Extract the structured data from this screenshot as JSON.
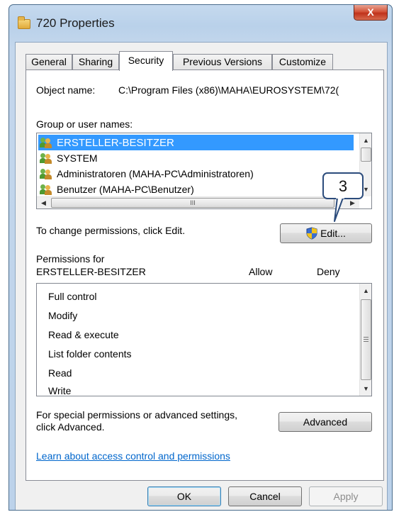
{
  "window": {
    "title": "720 Properties",
    "close_glyph": "X"
  },
  "tabs": [
    {
      "label": "General"
    },
    {
      "label": "Sharing"
    },
    {
      "label": "Security"
    },
    {
      "label": "Previous Versions"
    },
    {
      "label": "Customize"
    }
  ],
  "object": {
    "label": "Object name:",
    "value": "C:\\Program Files (x86)\\MAHA\\EUROSYSTEM\\72("
  },
  "groups": {
    "label": "Group or user names:",
    "items": [
      {
        "name": "ERSTELLER-BESITZER"
      },
      {
        "name": "SYSTEM"
      },
      {
        "name": "Administratoren (MAHA-PC\\Administratoren)"
      },
      {
        "name": "Benutzer (MAHA-PC\\Benutzer)"
      }
    ],
    "hscroll_grip": "III"
  },
  "change_text": "To change permissions, click Edit.",
  "edit_button": "Edit...",
  "callout": {
    "number": "3"
  },
  "permissions": {
    "label_line1": "Permissions for",
    "label_line2": "ERSTELLER-BESITZER",
    "allow_header": "Allow",
    "deny_header": "Deny",
    "items": [
      {
        "name": "Full control"
      },
      {
        "name": "Modify"
      },
      {
        "name": "Read & execute"
      },
      {
        "name": "List folder contents"
      },
      {
        "name": "Read"
      },
      {
        "name": "Write"
      }
    ]
  },
  "advanced": {
    "text_line1": "For special permissions or advanced settings,",
    "text_line2": "click Advanced.",
    "button": "Advanced"
  },
  "link": "Learn about access control and permissions",
  "footer": {
    "ok": "OK",
    "cancel": "Cancel",
    "apply": "Apply"
  }
}
